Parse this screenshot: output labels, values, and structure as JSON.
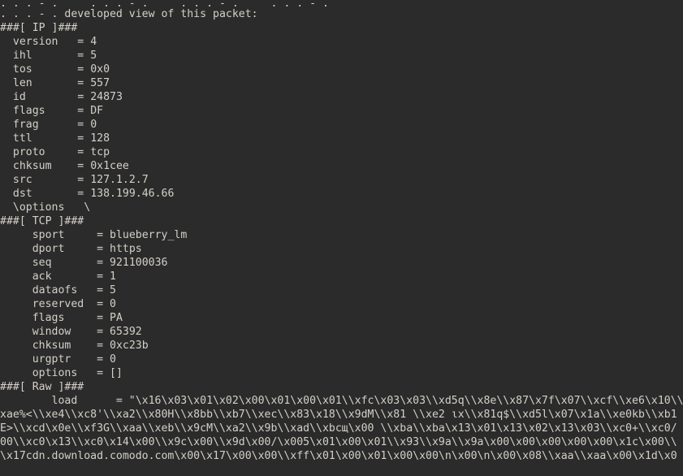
{
  "terminal": {
    "background_color": "#2b2b2b",
    "foreground_color": "#d4d0c8",
    "columns": 101,
    "rows": 34
  },
  "scrollback": {
    "clipped_top_line": ". . . - .     . . . - .     . . . - .     . . . - .",
    "intro_line": ". . . - . developed view of this packet:"
  },
  "layers": [
    {
      "header": "###[ IP ]###",
      "indent": "  ",
      "fields": [
        {
          "name": "version",
          "eq": "=",
          "value": "4"
        },
        {
          "name": "ihl",
          "eq": "=",
          "value": "5"
        },
        {
          "name": "tos",
          "eq": "=",
          "value": "0x0"
        },
        {
          "name": "len",
          "eq": "=",
          "value": "557"
        },
        {
          "name": "id",
          "eq": "=",
          "value": "24873"
        },
        {
          "name": "flags",
          "eq": "=",
          "value": "DF"
        },
        {
          "name": "frag",
          "eq": "=",
          "value": "0"
        },
        {
          "name": "ttl",
          "eq": "=",
          "value": "128"
        },
        {
          "name": "proto",
          "eq": "=",
          "value": "tcp"
        },
        {
          "name": "chksum",
          "eq": "=",
          "value": "0x1cee"
        },
        {
          "name": "src",
          "eq": "=",
          "value": "127.1.2.7"
        },
        {
          "name": "dst",
          "eq": "=",
          "value": "138.199.46.66"
        }
      ],
      "options_line": "  \\options   \\"
    },
    {
      "header": "###[ TCP ]###",
      "indent": "     ",
      "fields": [
        {
          "name": "sport",
          "eq": "=",
          "value": "blueberry_lm"
        },
        {
          "name": "dport",
          "eq": "=",
          "value": "https"
        },
        {
          "name": "seq",
          "eq": "=",
          "value": "921100036"
        },
        {
          "name": "ack",
          "eq": "=",
          "value": "1"
        },
        {
          "name": "dataofs",
          "eq": "=",
          "value": "5"
        },
        {
          "name": "reserved",
          "eq": "=",
          "value": "0"
        },
        {
          "name": "flags",
          "eq": "=",
          "value": "PA"
        },
        {
          "name": "window",
          "eq": "=",
          "value": "65392"
        },
        {
          "name": "chksum",
          "eq": "=",
          "value": "0xc23b"
        },
        {
          "name": "urgptr",
          "eq": "=",
          "value": "0"
        },
        {
          "name": "options",
          "eq": "=",
          "value": "[]"
        }
      ],
      "options_line": ""
    },
    {
      "header": "###[ Raw ]###",
      "indent": "        ",
      "fields": [],
      "options_line": ""
    }
  ],
  "raw_payload": {
    "label": "load",
    "eq": "=",
    "lines": [
      "        load      = \"\\x16\\x03\\x01\\x02\\x00\\x01\\x00\\x01\\\\xfc\\x03\\x03\\\\xd5q\\\\x8e\\\\x87\\x7f\\x07\\\\xcf\\\\xe6\\x10\\\\",
      "xae%<\\\\xe4\\\\xc8'\\\\xa2\\\\x80H\\\\x8bb\\\\xb7\\\\xec\\\\x83\\x18\\\\x9dM\\\\x81 \\\\xe2 ɩx\\\\x81q$\\\\xd5l\\x07\\x1a\\\\xe0kb\\\\xb1",
      "E>\\\\xcd\\x0e\\\\xf3G\\\\xaa\\\\xeb\\\\x9cM\\\\xa2\\\\x9b\\\\xad\\\\xbcщ\\x00 \\\\xba\\\\xba\\x13\\x01\\x13\\x02\\x13\\x03\\\\xc0+\\\\xc0/",
      "00\\\\xc0\\x13\\\\xc0\\x14\\x00\\\\x9c\\x00\\\\x9d\\x00/\\x005\\x01\\x00\\x01\\\\x93\\\\x9a\\\\x9a\\x00\\x00\\x00\\x00\\x00\\x1c\\x00\\\\",
      "\\x17cdn.download.comodo.com\\x00\\x17\\x00\\x00\\\\xff\\x01\\x00\\x01\\x00\\x00\\n\\x00\\n\\x00\\x08\\\\xaa\\\\xaa\\x00\\x1d\\x0"
    ]
  }
}
